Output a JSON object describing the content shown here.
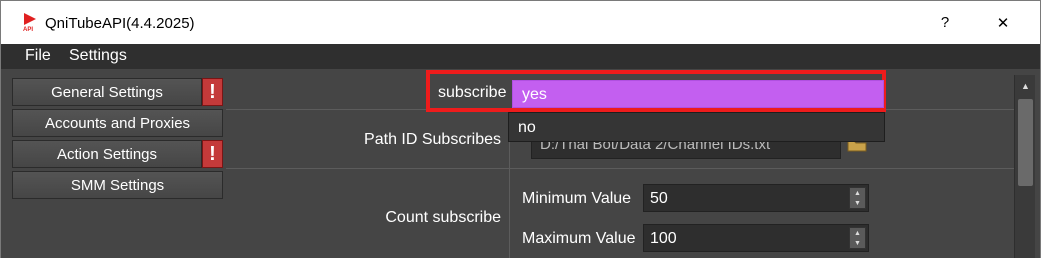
{
  "window": {
    "title": "QniTubeAPI(4.4.2025)",
    "help_symbol": "?",
    "close_symbol": "✕"
  },
  "menu": {
    "file": "File",
    "settings": "Settings"
  },
  "sidebar": {
    "items": [
      {
        "label": "General Settings",
        "warning": true
      },
      {
        "label": "Accounts and Proxies",
        "warning": false
      },
      {
        "label": "Action Settings",
        "warning": true
      },
      {
        "label": "SMM Settings",
        "warning": false
      }
    ],
    "warning_symbol": "!"
  },
  "form": {
    "subscribe_label": "subscribe",
    "subscribe_selected": "yes",
    "subscribe_options": [
      "yes",
      "no"
    ],
    "path_label": "Path ID Subscribes",
    "path_value": "D:/Thai Bot/Data 2/Channel IDs.txt",
    "count_label": "Count subscribe",
    "min_label": "Minimum Value",
    "min_value": "50",
    "max_label": "Maximum Value",
    "max_value": "100"
  },
  "icons": {
    "app": "youtube-api-icon",
    "folder": "folder-icon",
    "spin_up": "▲",
    "spin_down": "▼",
    "scroll_up": "▲"
  },
  "colors": {
    "highlight": "#c35ff0",
    "focus_border": "#ee1c1c",
    "warning": "#c43a3a"
  }
}
